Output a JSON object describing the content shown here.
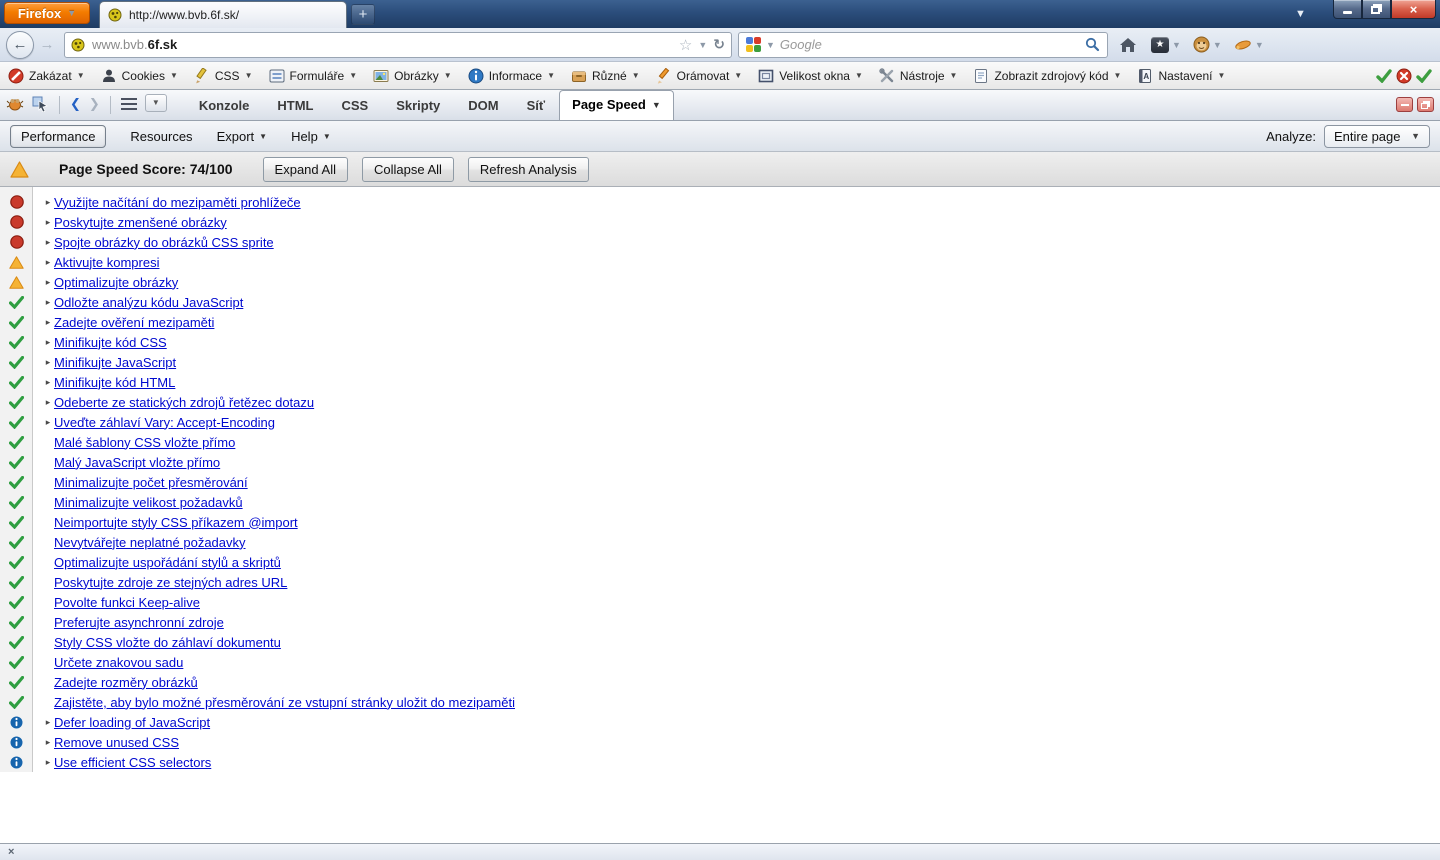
{
  "window": {
    "firefox_button_label": "Firefox",
    "tab_title": "http://www.bvb.6f.sk/",
    "new_tab_label": "+",
    "close_glyph": "×"
  },
  "navbar": {
    "url_prefix": "www.bvb.",
    "url_domain": "6f.sk",
    "search_placeholder": "Google"
  },
  "webdev_toolbar": {
    "items": [
      {
        "icon": "block-icon",
        "label": "Zakázat"
      },
      {
        "icon": "cookies-icon",
        "label": "Cookies"
      },
      {
        "icon": "css-pencil-icon",
        "label": "CSS"
      },
      {
        "icon": "forms-icon",
        "label": "Formuláře"
      },
      {
        "icon": "images-icon",
        "label": "Obrázky"
      },
      {
        "icon": "information-icon",
        "label": "Informace"
      },
      {
        "icon": "miscellaneous-icon",
        "label": "Různé"
      },
      {
        "icon": "outline-icon",
        "label": "Orámovat"
      },
      {
        "icon": "resize-icon",
        "label": "Velikost okna"
      },
      {
        "icon": "tools-icon",
        "label": "Nástroje"
      },
      {
        "icon": "view-source-icon",
        "label": "Zobrazit zdrojový kód"
      },
      {
        "icon": "options-icon",
        "label": "Nastavení"
      }
    ]
  },
  "firebug": {
    "tabs": [
      "Konzole",
      "HTML",
      "CSS",
      "Skripty",
      "DOM",
      "Síť",
      "Page Speed"
    ],
    "active_tab": "Page Speed"
  },
  "pagespeed": {
    "menu": [
      {
        "label": "Performance",
        "selected": true,
        "caret": false
      },
      {
        "label": "Resources",
        "selected": false,
        "caret": false
      },
      {
        "label": "Export",
        "selected": false,
        "caret": true
      },
      {
        "label": "Help",
        "selected": false,
        "caret": true
      }
    ],
    "analyze_label": "Analyze:",
    "analyze_value": "Entire page",
    "score_text": "Page Speed Score: 74/100",
    "score_status": "warning",
    "buttons": [
      "Expand All",
      "Collapse All",
      "Refresh Analysis"
    ],
    "status_colors": {
      "fail": "#c93a2c",
      "warning": "#f5b335",
      "pass": "#2f9e41",
      "info": "#1765ad"
    },
    "rules": [
      {
        "status": "fail",
        "expandable": true,
        "label": "Využijte načítání do mezipaměti prohlížeče"
      },
      {
        "status": "fail",
        "expandable": true,
        "label": "Poskytujte zmenšené obrázky"
      },
      {
        "status": "fail",
        "expandable": true,
        "label": "Spojte obrázky do obrázků CSS sprite"
      },
      {
        "status": "warning",
        "expandable": true,
        "label": "Aktivujte kompresi"
      },
      {
        "status": "warning",
        "expandable": true,
        "label": "Optimalizujte obrázky"
      },
      {
        "status": "pass",
        "expandable": true,
        "label": "Odložte analýzu kódu JavaScript"
      },
      {
        "status": "pass",
        "expandable": true,
        "label": "Zadejte ověření mezipaměti"
      },
      {
        "status": "pass",
        "expandable": true,
        "label": "Minifikujte kód CSS"
      },
      {
        "status": "pass",
        "expandable": true,
        "label": "Minifikujte JavaScript"
      },
      {
        "status": "pass",
        "expandable": true,
        "label": "Minifikujte kód HTML"
      },
      {
        "status": "pass",
        "expandable": true,
        "label": "Odeberte ze statických zdrojů řetězec dotazu"
      },
      {
        "status": "pass",
        "expandable": true,
        "label": "Uveďte záhlaví Vary: Accept-Encoding"
      },
      {
        "status": "pass",
        "expandable": false,
        "label": "Malé šablony CSS vložte přímo"
      },
      {
        "status": "pass",
        "expandable": false,
        "label": "Malý JavaScript vložte přímo"
      },
      {
        "status": "pass",
        "expandable": false,
        "label": "Minimalizujte počet přesměrování"
      },
      {
        "status": "pass",
        "expandable": false,
        "label": "Minimalizujte velikost požadavků"
      },
      {
        "status": "pass",
        "expandable": false,
        "label": "Neimportujte styly CSS příkazem @import"
      },
      {
        "status": "pass",
        "expandable": false,
        "label": "Nevytvářejte neplatné požadavky"
      },
      {
        "status": "pass",
        "expandable": false,
        "label": "Optimalizujte uspořádání stylů a skriptů"
      },
      {
        "status": "pass",
        "expandable": false,
        "label": "Poskytujte zdroje ze stejných adres URL"
      },
      {
        "status": "pass",
        "expandable": false,
        "label": "Povolte funkci Keep-alive"
      },
      {
        "status": "pass",
        "expandable": false,
        "label": "Preferujte asynchronní zdroje"
      },
      {
        "status": "pass",
        "expandable": false,
        "label": "Styly CSS vložte do záhlaví dokumentu"
      },
      {
        "status": "pass",
        "expandable": false,
        "label": "Určete znakovou sadu"
      },
      {
        "status": "pass",
        "expandable": false,
        "label": "Zadejte rozměry obrázků"
      },
      {
        "status": "pass",
        "expandable": false,
        "label": "Zajistěte, aby bylo možné přesměrování ze vstupní stránky uložit do mezipaměti"
      },
      {
        "status": "info",
        "expandable": true,
        "label": "Defer loading of JavaScript"
      },
      {
        "status": "info",
        "expandable": true,
        "label": "Remove unused CSS"
      },
      {
        "status": "info",
        "expandable": true,
        "label": "Use efficient CSS selectors"
      }
    ]
  }
}
